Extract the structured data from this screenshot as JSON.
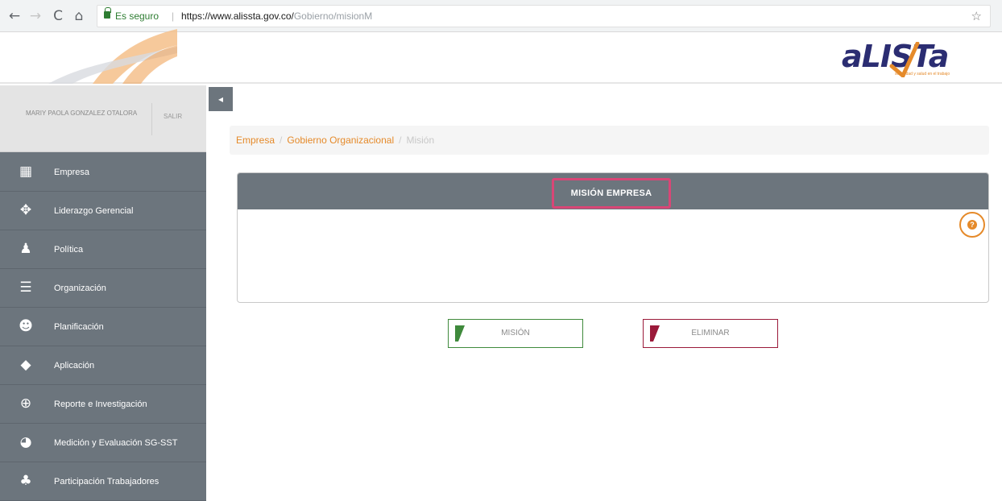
{
  "browser": {
    "back": "←",
    "forward": "→",
    "reload": "C",
    "home": "⌂",
    "secure_label": "Es seguro",
    "separator": "|",
    "url_domain": "https://www.alissta.gov.co/",
    "url_path": "Gobierno/misionM",
    "bookmark": "☆"
  },
  "header": {
    "logo_text": "aLISTa",
    "logo_tagline": "seguridad y salud en el trabajo"
  },
  "user": {
    "name": "MARIY PAOLA GONZALEZ OTALORA",
    "logout_label": "SALIR"
  },
  "sidebar": {
    "collapse_icon": "◂",
    "items": [
      {
        "label": "Empresa",
        "icon": "building-icon",
        "glyph": "▦"
      },
      {
        "label": "Liderazgo Gerencial",
        "icon": "leadership-icon",
        "glyph": "✥"
      },
      {
        "label": "Política",
        "icon": "person-icon",
        "glyph": "♟"
      },
      {
        "label": "Organización",
        "icon": "list-icon",
        "glyph": "☰"
      },
      {
        "label": "Planificación",
        "icon": "head-icon",
        "glyph": "☻"
      },
      {
        "label": "Aplicación",
        "icon": "tag-icon",
        "glyph": "◆"
      },
      {
        "label": "Reporte e Investigación",
        "icon": "magnifier-icon",
        "glyph": "⊕"
      },
      {
        "label": "Medición y Evaluación SG-SST",
        "icon": "pie-chart-icon",
        "glyph": "◕"
      },
      {
        "label": "Participación Trabajadores",
        "icon": "group-icon",
        "glyph": "♣"
      }
    ]
  },
  "breadcrumb": {
    "items": [
      "Empresa",
      "Gobierno Organizacional"
    ],
    "active": "Misión",
    "separator": "/"
  },
  "panel": {
    "title": "MISIÓN EMPRESA",
    "help_glyph": "?"
  },
  "actions": {
    "mision_label": "MISIÓN",
    "eliminar_label": "ELIMINAR"
  },
  "colors": {
    "accent": "#e58a2a",
    "sidebar": "#6c757d",
    "highlight": "#d94676",
    "mision": "#3f8a3c",
    "eliminar": "#9b1a3a",
    "brand": "#2b2d72"
  }
}
